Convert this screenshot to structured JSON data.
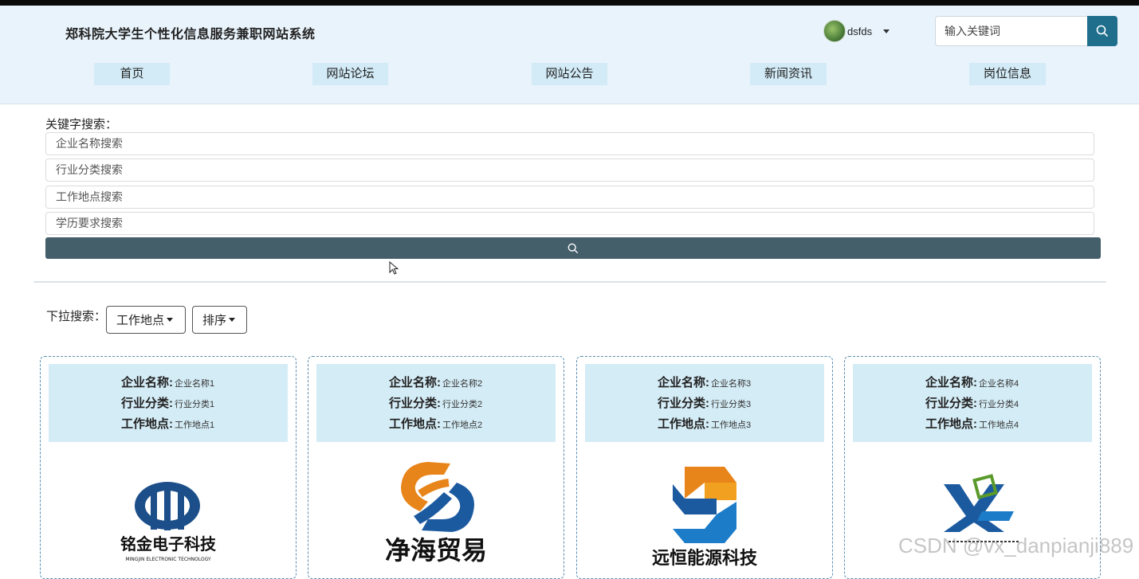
{
  "header": {
    "site_title": "郑科院大学生个性化信息服务兼职网站系统",
    "user_name": "dsfds",
    "search_placeholder": "输入关键词"
  },
  "nav": [
    {
      "label": "首页"
    },
    {
      "label": "网站论坛"
    },
    {
      "label": "网站公告"
    },
    {
      "label": "新闻资讯"
    },
    {
      "label": "岗位信息"
    }
  ],
  "keyword_search": {
    "label": "关键字搜索：",
    "fields": [
      {
        "placeholder": "企业名称搜索"
      },
      {
        "placeholder": "行业分类搜索"
      },
      {
        "placeholder": "工作地点搜索"
      },
      {
        "placeholder": "学历要求搜索"
      }
    ]
  },
  "dropdown_search": {
    "label": "下拉搜索：",
    "location_label": "工作地点",
    "sort_label": "排序"
  },
  "cards": [
    {
      "company_label": "企业名称:",
      "company": "企业名称1",
      "industry_label": "行业分类:",
      "industry": "行业分类1",
      "location_label": "工作地点:",
      "location": "工作地点1",
      "logo_text": "铭金电子科技",
      "logo_subtext": "MINGJIN ELECTRONIC TECHNOLOGY"
    },
    {
      "company_label": "企业名称:",
      "company": "企业名称2",
      "industry_label": "行业分类:",
      "industry": "行业分类2",
      "location_label": "工作地点:",
      "location": "工作地点2",
      "logo_text": "净海贸易",
      "logo_subtext": ""
    },
    {
      "company_label": "企业名称:",
      "company": "企业名称3",
      "industry_label": "行业分类:",
      "industry": "行业分类3",
      "location_label": "工作地点:",
      "location": "工作地点3",
      "logo_text": "远恒能源科技",
      "logo_subtext": ""
    },
    {
      "company_label": "企业名称:",
      "company": "企业名称4",
      "industry_label": "行业分类:",
      "industry": "行业分类4",
      "location_label": "工作地点:",
      "location": "工作地点4",
      "logo_text": "",
      "logo_subtext": ""
    }
  ],
  "watermark": "CSDN @vx_danpianji889",
  "colors": {
    "header_bg": "#e9f3fb",
    "nav_bg": "#d2ebf7",
    "search_btn": "#1f6e8c",
    "keyword_btn": "#445e6a",
    "card_info_bg": "#d4ecf6"
  }
}
